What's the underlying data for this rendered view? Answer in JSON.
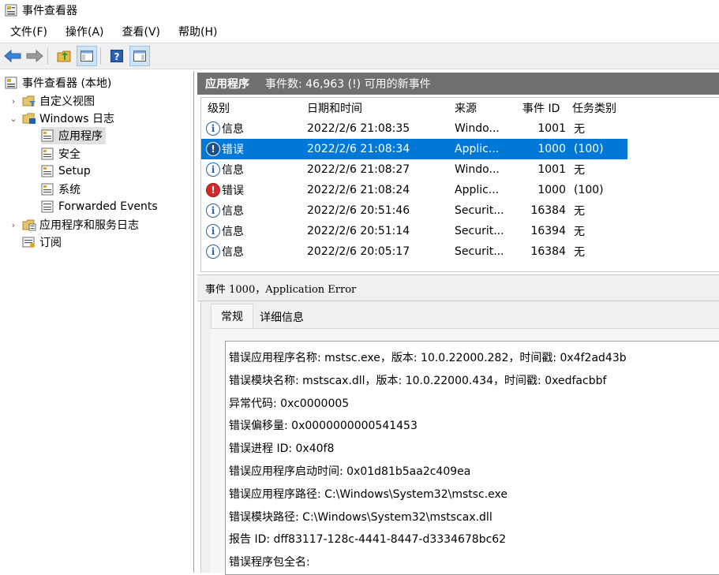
{
  "window": {
    "title": "事件查看器"
  },
  "menu": [
    "文件(F)",
    "操作(A)",
    "查看(V)",
    "帮助(H)"
  ],
  "tree": {
    "root": "事件查看器 (本地)",
    "custom_views": "自定义视图",
    "windows_logs": "Windows 日志",
    "application": "应用程序",
    "security": "安全",
    "setup": "Setup",
    "system": "系统",
    "forwarded": "Forwarded Events",
    "app_service_logs": "应用程序和服务日志",
    "subscriptions": "订阅"
  },
  "pane": {
    "title": "应用程序",
    "count": "事件数: 46,963 (!) 可用的新事件"
  },
  "table": {
    "columns": [
      "级别",
      "日期和时间",
      "来源",
      "事件 ID",
      "任务类别"
    ],
    "rows": [
      {
        "level": "信息",
        "level_type": "info",
        "datetime": "2022/2/6 21:08:35",
        "source": "Windo...",
        "event_id": "1001",
        "task": "无"
      },
      {
        "level": "错误",
        "level_type": "error",
        "datetime": "2022/2/6 21:08:34",
        "source": "Applic...",
        "event_id": "1000",
        "task": "(100)",
        "selected": true
      },
      {
        "level": "信息",
        "level_type": "info",
        "datetime": "2022/2/6 21:08:27",
        "source": "Windo...",
        "event_id": "1001",
        "task": "无"
      },
      {
        "level": "错误",
        "level_type": "error",
        "datetime": "2022/2/6 21:08:24",
        "source": "Applic...",
        "event_id": "1000",
        "task": "(100)"
      },
      {
        "level": "信息",
        "level_type": "info",
        "datetime": "2022/2/6 20:51:46",
        "source": "Securit...",
        "event_id": "16384",
        "task": "无"
      },
      {
        "level": "信息",
        "level_type": "info",
        "datetime": "2022/2/6 20:51:14",
        "source": "Securit...",
        "event_id": "16394",
        "task": "无"
      },
      {
        "level": "信息",
        "level_type": "info",
        "datetime": "2022/2/6 20:05:17",
        "source": "Securit...",
        "event_id": "16384",
        "task": "无"
      }
    ]
  },
  "detail": {
    "header": "事件 1000，Application Error",
    "tabs": [
      "常规",
      "详细信息"
    ],
    "lines": [
      "错误应用程序名称: mstsc.exe，版本: 10.0.22000.282，时间戳: 0x4f2ad43b",
      "错误模块名称: mstscax.dll，版本: 10.0.22000.434，时间戳: 0xedfacbbf",
      "异常代码: 0xc0000005",
      "错误偏移量: 0x0000000000541453",
      "错误进程 ID: 0x40f8",
      "错误应用程序启动时间: 0x01d81b5aa2c409ea",
      "错误应用程序路径: C:\\Windows\\System32\\mstsc.exe",
      "错误模块路径: C:\\Windows\\System32\\mstscax.dll",
      "报告 ID: dff83117-128c-4441-8447-d3334678bc62",
      "错误程序包全名:"
    ]
  },
  "colors": {
    "selection": "#0078d7",
    "header_bar": "#6f6f6f",
    "error": "#d62a2a",
    "info": "#2d5fa3"
  }
}
